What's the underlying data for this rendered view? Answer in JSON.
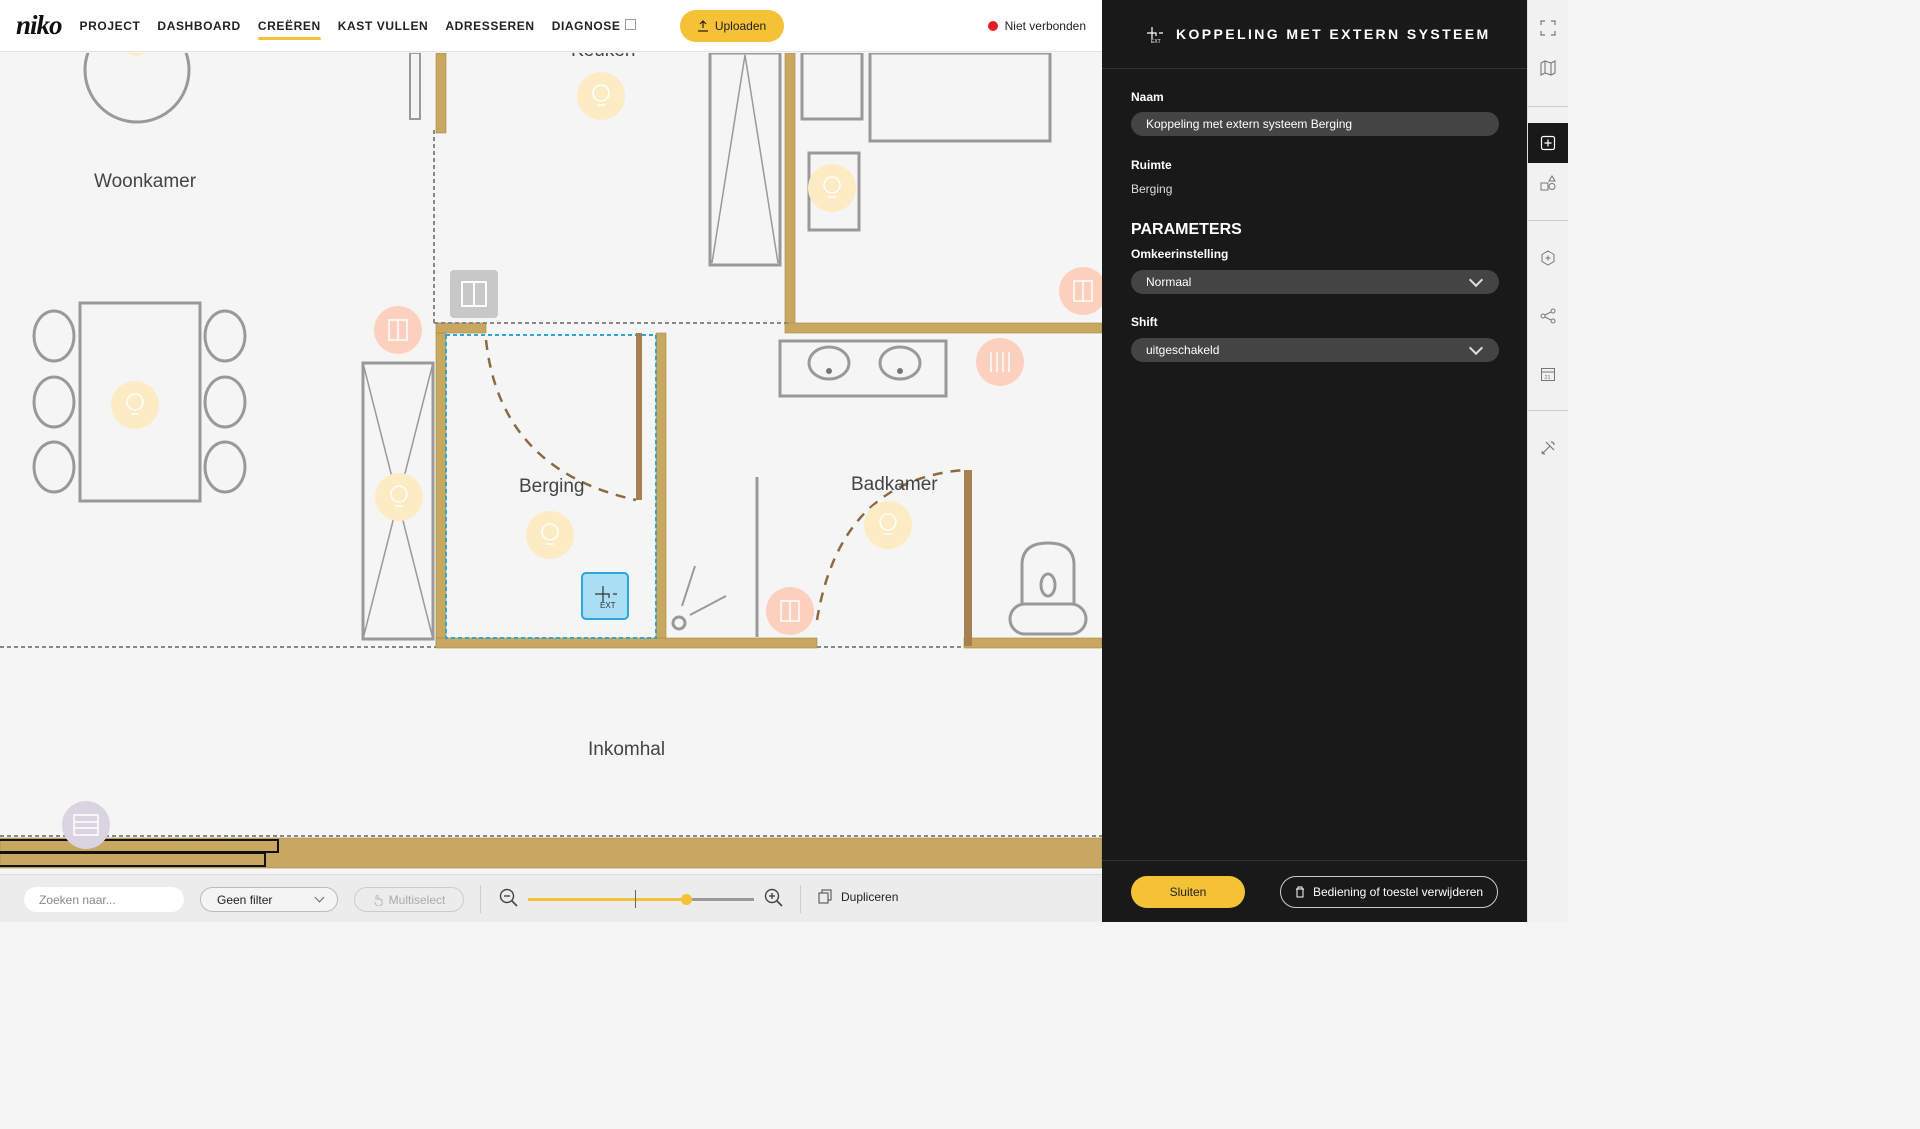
{
  "app": {
    "logo": "niko"
  },
  "nav": {
    "items": [
      {
        "label": "PROJECT",
        "active": false
      },
      {
        "label": "DASHBOARD",
        "active": false
      },
      {
        "label": "CREËREN",
        "active": true
      },
      {
        "label": "KAST VULLEN",
        "active": false
      },
      {
        "label": "ADRESSEREN",
        "active": false
      },
      {
        "label": "DIAGNOSE",
        "active": false
      }
    ],
    "upload_label": "Uploaden",
    "status_label": "Niet verbonden",
    "status_color": "#e41e26",
    "accent": "#f5c136"
  },
  "floorplan": {
    "rooms": [
      "Keuken",
      "Woonkamer",
      "Berging",
      "Badkamer",
      "Inkomhal"
    ],
    "selected_device_label": "EXT"
  },
  "bottombar": {
    "search_placeholder": "Zoeken naar...",
    "filter_label": "Geen filter",
    "multiselect_label": "Multiselect",
    "duplicate_label": "Dupliceren",
    "zoom_level": 0.7
  },
  "panel": {
    "title": "KOPPELING MET EXTERN SYSTEEM",
    "name_label": "Naam",
    "name_value": "Koppeling met extern systeem Berging",
    "room_label": "Ruimte",
    "room_value": "Berging",
    "params_title": "PARAMETERS",
    "reverse_label": "Omkeerinstelling",
    "reverse_value": "Normaal",
    "shift_label": "Shift",
    "shift_value": "uitgeschakeld",
    "close_label": "Sluiten",
    "delete_label": "Bediening of toestel verwijderen"
  },
  "rail": {
    "icons": [
      "expand-icon",
      "map-icon",
      "add-device-icon",
      "shapes-icon",
      "hexagon-plus-icon",
      "share-nodes-icon",
      "calendar-icon",
      "tools-icon"
    ]
  }
}
